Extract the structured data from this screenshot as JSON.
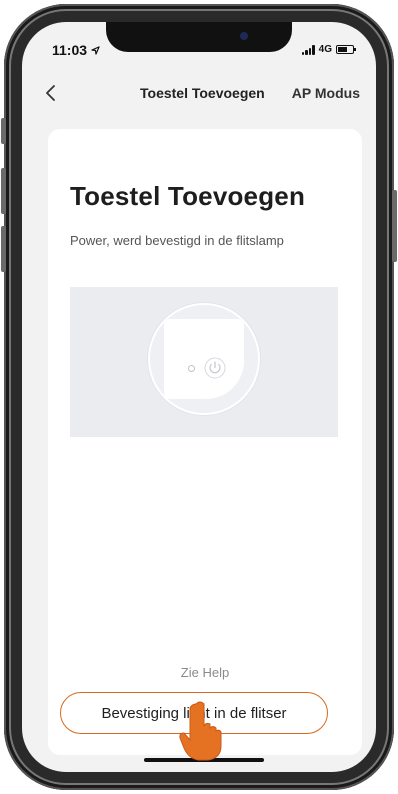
{
  "status_bar": {
    "time": "11:03",
    "location_icon": "location-arrow-icon",
    "network": "4G"
  },
  "nav": {
    "back_icon": "chevron-left-icon",
    "title": "Toestel Toevoegen",
    "mode_label": "AP Modus"
  },
  "card": {
    "title": "Toestel Toevoegen",
    "subtitle": "Power, werd bevestigd in de flitslamp",
    "illustration": {
      "power_icon": "power-icon",
      "led_icon": "led-indicator-icon"
    },
    "help_link": "Zie Help",
    "confirm_button": "Bevestiging licht in de flitser"
  },
  "colors": {
    "accent": "#d7691f",
    "screen_bg": "#f2f2f2",
    "card_bg": "#ffffff",
    "illustration_bg": "#eaecf0"
  }
}
